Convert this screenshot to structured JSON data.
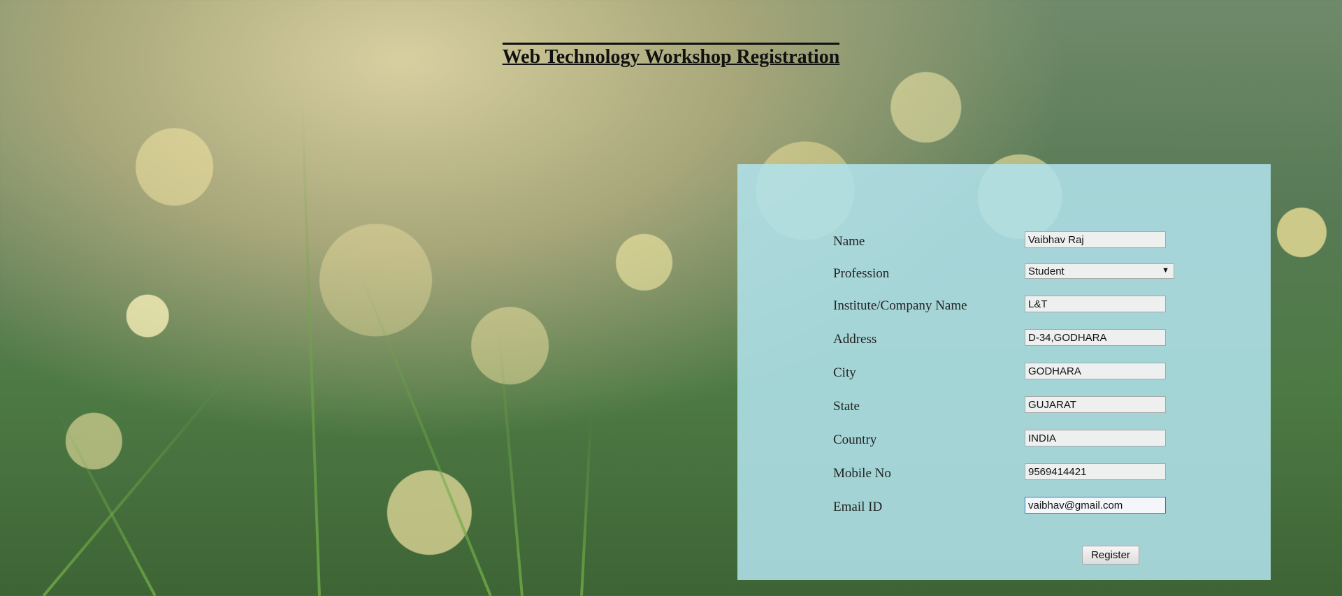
{
  "page": {
    "title": "Web Technology Workshop Registration"
  },
  "form": {
    "fields": [
      {
        "label": "Name",
        "value": "Vaibhav Raj"
      },
      {
        "label": "Profession",
        "value": "Student"
      },
      {
        "label": "Institute/Company Name",
        "value": "L&T"
      },
      {
        "label": "Address",
        "value": "D-34,GODHARA"
      },
      {
        "label": "City",
        "value": "GODHARA"
      },
      {
        "label": "State",
        "value": "GUJARAT"
      },
      {
        "label": "Country",
        "value": "INDIA"
      },
      {
        "label": "Mobile No",
        "value": "9569414421"
      },
      {
        "label": "Email ID",
        "value": "vaibhav@gmail.com"
      }
    ],
    "register_label": "Register"
  },
  "icons": {
    "profession_caret": "chevron-down-icon"
  },
  "colors": {
    "panel_background": "#b0e1eb",
    "focus_border": "#3b6fd6"
  }
}
